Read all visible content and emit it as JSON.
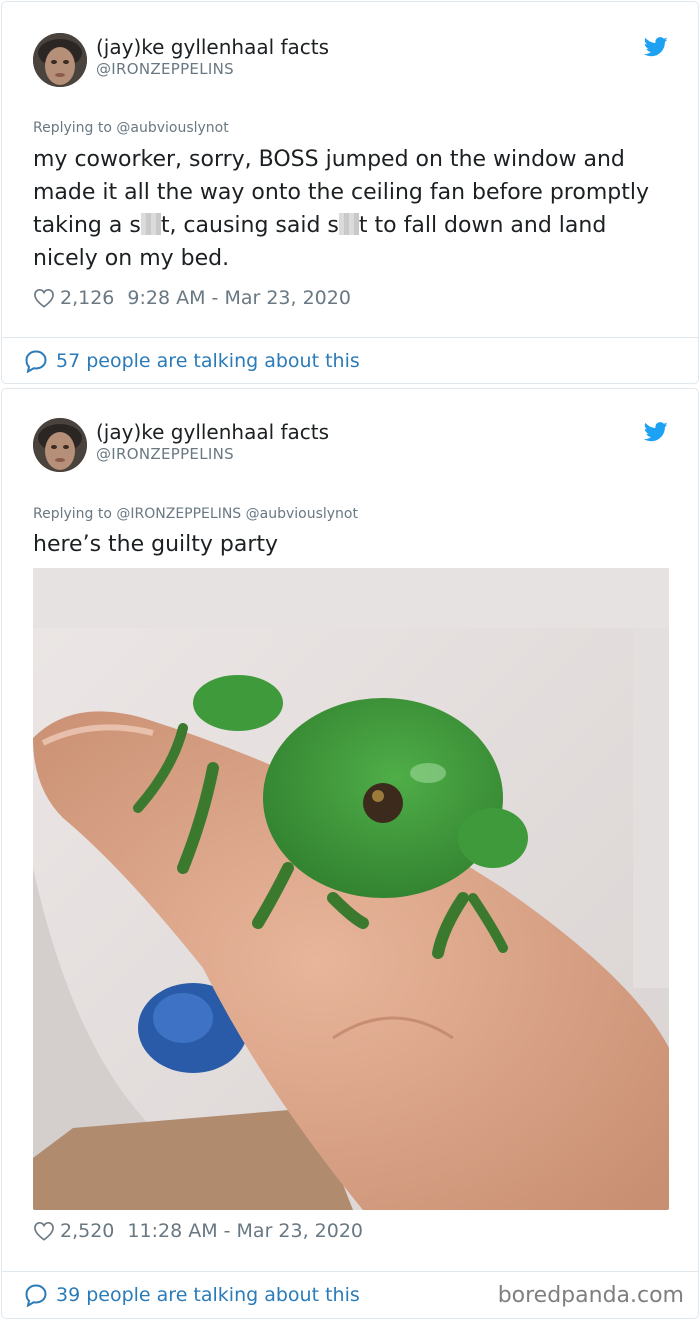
{
  "tweets": [
    {
      "author": {
        "name": "(jay)ke gyllenhaal facts",
        "handle": "@IRONZEPPELINS"
      },
      "replying_to": "Replying to @aubviouslynot",
      "text_parts": [
        "my coworker, sorry, BOSS jumped on the window and made it all the way onto the ceiling fan before promptly taking a s",
        "t, causing said s",
        "t to fall down and land nicely on my bed."
      ],
      "likes": "2,126",
      "timestamp": "9:28 AM - Mar 23, 2020",
      "talking": "57 people are talking about this"
    },
    {
      "author": {
        "name": "(jay)ke gyllenhaal facts",
        "handle": "@IRONZEPPELINS"
      },
      "replying_to": "Replying to @IRONZEPPELINS @aubviouslynot",
      "text": "here’s the guilty party",
      "likes": "2,520",
      "timestamp": "11:28 AM - Mar 23, 2020",
      "talking": "39 people are talking about this"
    }
  ],
  "watermark": "boredpanda.com",
  "colors": {
    "link": "#2b7bb9",
    "muted": "#697882",
    "twitter_blue": "#1da1f2",
    "frog_green": "#3f9a3c"
  },
  "icons": [
    "twitter-bird-icon",
    "heart-icon",
    "speech-bubble-icon"
  ]
}
